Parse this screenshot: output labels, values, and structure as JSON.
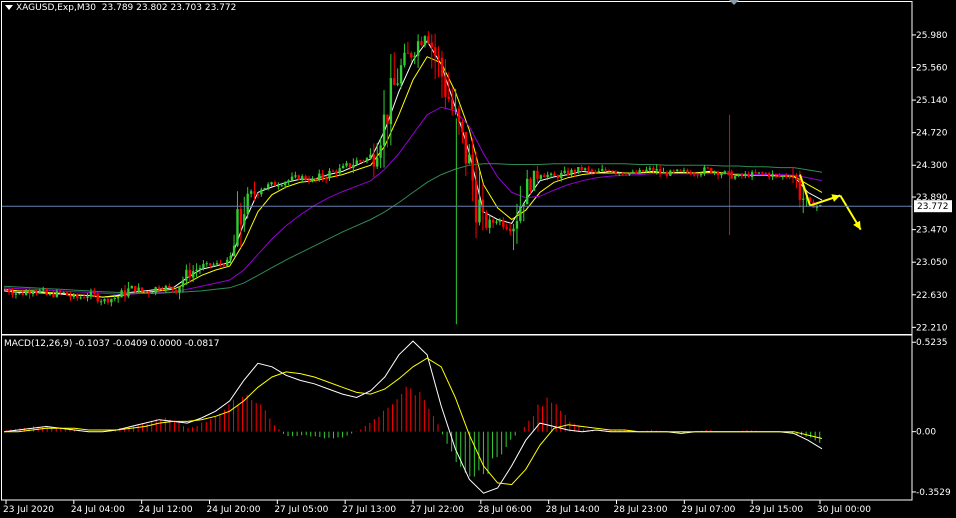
{
  "header": {
    "symbol_text": "XAGUSD,Exp,M30",
    "ohlc_text": "23.789 23.802 23.703 23.772",
    "macd_text": "MACD(12,26,9) -0.1037 -0.0409 0.0000 -0.0817"
  },
  "colors": {
    "background": "#000000",
    "axes": "#ffffff",
    "grid": "#c0c0c0",
    "bull": "#32cd32",
    "bear": "#ff0000",
    "ma_fast": "#ffffff",
    "ma_mid": "#ffff00",
    "ma_slow": "#9400d3",
    "ma_long": "#2e8b57",
    "price_line": "#6b7fb0",
    "macd_pos": "#ff0000",
    "macd_neg": "#32cd32",
    "forecast": "#ffff00"
  },
  "chart_data": [
    {
      "type": "candlestick",
      "title": "XAGUSD,Exp,M30",
      "current_price": 23.772,
      "current_price_label": "23.772",
      "ylim": [
        22.15,
        26.25
      ],
      "ytick_labels": [
        "25.980",
        "25.560",
        "25.140",
        "24.720",
        "24.300",
        "23.890",
        "23.470",
        "23.050",
        "22.630",
        "22.210"
      ],
      "yticks": [
        25.98,
        25.56,
        25.14,
        24.72,
        24.3,
        23.89,
        23.47,
        23.05,
        22.63,
        22.21
      ],
      "xtick_labels": [
        "23 Jul 2020",
        "24 Jul 04:00",
        "24 Jul 12:00",
        "24 Jul 20:00",
        "27 Jul 05:00",
        "27 Jul 13:00",
        "27 Jul 22:00",
        "28 Jul 06:00",
        "28 Jul 14:00",
        "28 Jul 23:00",
        "29 Jul 07:00",
        "29 Jul 15:00",
        "30 Jul 00:00"
      ],
      "close_path": [
        22.7,
        22.64,
        22.7,
        22.62,
        22.66,
        22.58,
        22.64,
        22.56,
        22.6,
        22.72,
        22.66,
        22.74,
        22.7,
        22.9,
        23.0,
        23.02,
        23.05,
        23.8,
        24.0,
        24.05,
        24.1,
        24.15,
        24.1,
        24.2,
        24.25,
        24.35,
        24.4,
        24.9,
        25.5,
        25.8,
        26.05,
        25.5,
        24.9,
        24.3,
        23.5,
        23.6,
        23.5,
        24.0,
        24.2,
        24.15,
        24.2,
        24.25,
        24.2,
        24.25,
        24.2,
        24.2,
        24.25,
        24.18,
        24.22,
        24.2,
        24.25,
        24.2,
        24.15,
        24.18,
        24.2,
        24.15,
        24.18,
        23.8,
        23.772
      ],
      "spikes": [
        {
          "bar_fraction": 0.553,
          "low": 22.25
        },
        {
          "bar_fraction": 0.887,
          "high": 24.95,
          "low": 23.4
        }
      ],
      "series": [
        {
          "role": "ma_fast",
          "values": [
            22.68,
            22.66,
            22.66,
            22.65,
            22.64,
            22.62,
            22.62,
            22.6,
            22.62,
            22.66,
            22.68,
            22.7,
            22.72,
            22.85,
            22.96,
            23.0,
            23.05,
            23.55,
            23.95,
            24.02,
            24.08,
            24.12,
            24.12,
            24.18,
            24.22,
            24.3,
            24.38,
            24.75,
            25.25,
            25.65,
            25.9,
            25.6,
            25.05,
            24.45,
            23.7,
            23.6,
            23.55,
            23.85,
            24.1,
            24.15,
            24.18,
            24.22,
            24.2,
            24.22,
            24.2,
            24.2,
            24.22,
            24.2,
            24.21,
            24.2,
            24.22,
            24.2,
            24.17,
            24.17,
            24.18,
            24.16,
            24.16,
            23.95,
            23.85
          ]
        },
        {
          "role": "ma_mid",
          "values": [
            22.7,
            22.68,
            22.68,
            22.66,
            22.65,
            22.63,
            22.62,
            22.6,
            22.61,
            22.64,
            22.66,
            22.68,
            22.7,
            22.78,
            22.88,
            22.95,
            23.0,
            23.3,
            23.7,
            23.92,
            24.02,
            24.08,
            24.1,
            24.14,
            24.18,
            24.24,
            24.3,
            24.55,
            24.95,
            25.4,
            25.7,
            25.62,
            25.25,
            24.75,
            24.05,
            23.75,
            23.6,
            23.72,
            23.95,
            24.08,
            24.14,
            24.18,
            24.2,
            24.2,
            24.2,
            24.2,
            24.21,
            24.2,
            24.2,
            24.2,
            24.21,
            24.2,
            24.18,
            24.17,
            24.17,
            24.16,
            24.16,
            24.05,
            23.95
          ]
        },
        {
          "role": "ma_slow",
          "values": [
            22.72,
            22.71,
            22.7,
            22.69,
            22.68,
            22.67,
            22.66,
            22.65,
            22.64,
            22.64,
            22.65,
            22.66,
            22.67,
            22.7,
            22.74,
            22.78,
            22.82,
            22.95,
            23.15,
            23.35,
            23.52,
            23.66,
            23.78,
            23.88,
            23.96,
            24.03,
            24.1,
            24.25,
            24.45,
            24.7,
            24.95,
            25.05,
            25.0,
            24.8,
            24.45,
            24.15,
            23.95,
            23.88,
            23.9,
            23.98,
            24.05,
            24.1,
            24.14,
            24.16,
            24.17,
            24.18,
            24.19,
            24.19,
            24.19,
            24.19,
            24.19,
            24.19,
            24.19,
            24.18,
            24.18,
            24.18,
            24.17,
            24.14,
            24.1
          ]
        },
        {
          "role": "ma_long",
          "values": [
            22.74,
            22.73,
            22.72,
            22.71,
            22.7,
            22.69,
            22.68,
            22.67,
            22.66,
            22.65,
            22.65,
            22.65,
            22.66,
            22.67,
            22.68,
            22.7,
            22.72,
            22.78,
            22.88,
            22.98,
            23.08,
            23.17,
            23.26,
            23.35,
            23.44,
            23.52,
            23.6,
            23.7,
            23.82,
            23.95,
            24.08,
            24.18,
            24.25,
            24.3,
            24.32,
            24.32,
            24.31,
            24.31,
            24.31,
            24.32,
            24.32,
            24.32,
            24.32,
            24.32,
            24.32,
            24.31,
            24.31,
            24.3,
            24.3,
            24.3,
            24.3,
            24.29,
            24.29,
            24.28,
            24.28,
            24.27,
            24.27,
            24.24,
            24.21
          ]
        }
      ],
      "forecast_arrow": [
        {
          "x_fraction": 0.0,
          "y": 23.78
        },
        {
          "x_fraction": 0.037,
          "y": 23.91
        },
        {
          "x_fraction": 0.062,
          "y": 23.47
        }
      ]
    },
    {
      "type": "bar",
      "title": "MACD(12,26,9)",
      "ylim": [
        -0.4,
        0.56
      ],
      "ytick_labels": [
        "0.5235",
        "0.00",
        "-0.3529"
      ],
      "yticks": [
        0.5235,
        0.0,
        -0.3529
      ],
      "histogram": [
        0.01,
        0.02,
        0.03,
        0.03,
        0.02,
        0.01,
        0.0,
        0.0,
        0.02,
        0.03,
        0.05,
        0.08,
        0.06,
        0.02,
        0.05,
        0.1,
        0.15,
        0.22,
        0.18,
        0.05,
        -0.03,
        -0.02,
        -0.03,
        -0.04,
        -0.03,
        0.0,
        0.05,
        0.12,
        0.22,
        0.25,
        0.18,
        0.0,
        -0.15,
        -0.24,
        -0.25,
        -0.15,
        -0.05,
        0.03,
        0.15,
        0.2,
        0.08,
        0.02,
        0.0,
        0.01,
        0.01,
        0.0,
        0.01,
        0.0,
        -0.01,
        0.0,
        0.01,
        0.0,
        0.0,
        0.01,
        0.0,
        0.0,
        -0.01,
        -0.03,
        -0.06
      ],
      "macd_line": [
        0.0,
        0.01,
        0.02,
        0.03,
        0.02,
        0.01,
        0.0,
        0.0,
        0.01,
        0.03,
        0.05,
        0.07,
        0.06,
        0.05,
        0.08,
        0.12,
        0.18,
        0.3,
        0.4,
        0.38,
        0.33,
        0.3,
        0.28,
        0.25,
        0.22,
        0.2,
        0.24,
        0.32,
        0.45,
        0.53,
        0.45,
        0.15,
        -0.1,
        -0.28,
        -0.36,
        -0.33,
        -0.2,
        -0.05,
        0.05,
        0.03,
        0.01,
        0.0,
        0.01,
        0.0,
        0.0,
        0.0,
        0.0,
        0.0,
        -0.01,
        0.0,
        0.0,
        0.0,
        0.0,
        0.0,
        0.0,
        0.0,
        -0.01,
        -0.05,
        -0.1
      ],
      "signal_line": [
        0.0,
        0.0,
        0.01,
        0.02,
        0.02,
        0.02,
        0.01,
        0.01,
        0.01,
        0.02,
        0.03,
        0.05,
        0.06,
        0.06,
        0.07,
        0.09,
        0.12,
        0.18,
        0.26,
        0.32,
        0.35,
        0.34,
        0.32,
        0.29,
        0.26,
        0.23,
        0.22,
        0.25,
        0.31,
        0.38,
        0.43,
        0.38,
        0.2,
        -0.02,
        -0.2,
        -0.3,
        -0.31,
        -0.22,
        -0.08,
        0.02,
        0.04,
        0.03,
        0.02,
        0.01,
        0.01,
        0.0,
        0.0,
        0.0,
        0.0,
        0.0,
        0.0,
        0.0,
        0.0,
        0.0,
        0.0,
        0.0,
        0.0,
        -0.02,
        -0.04
      ]
    }
  ]
}
